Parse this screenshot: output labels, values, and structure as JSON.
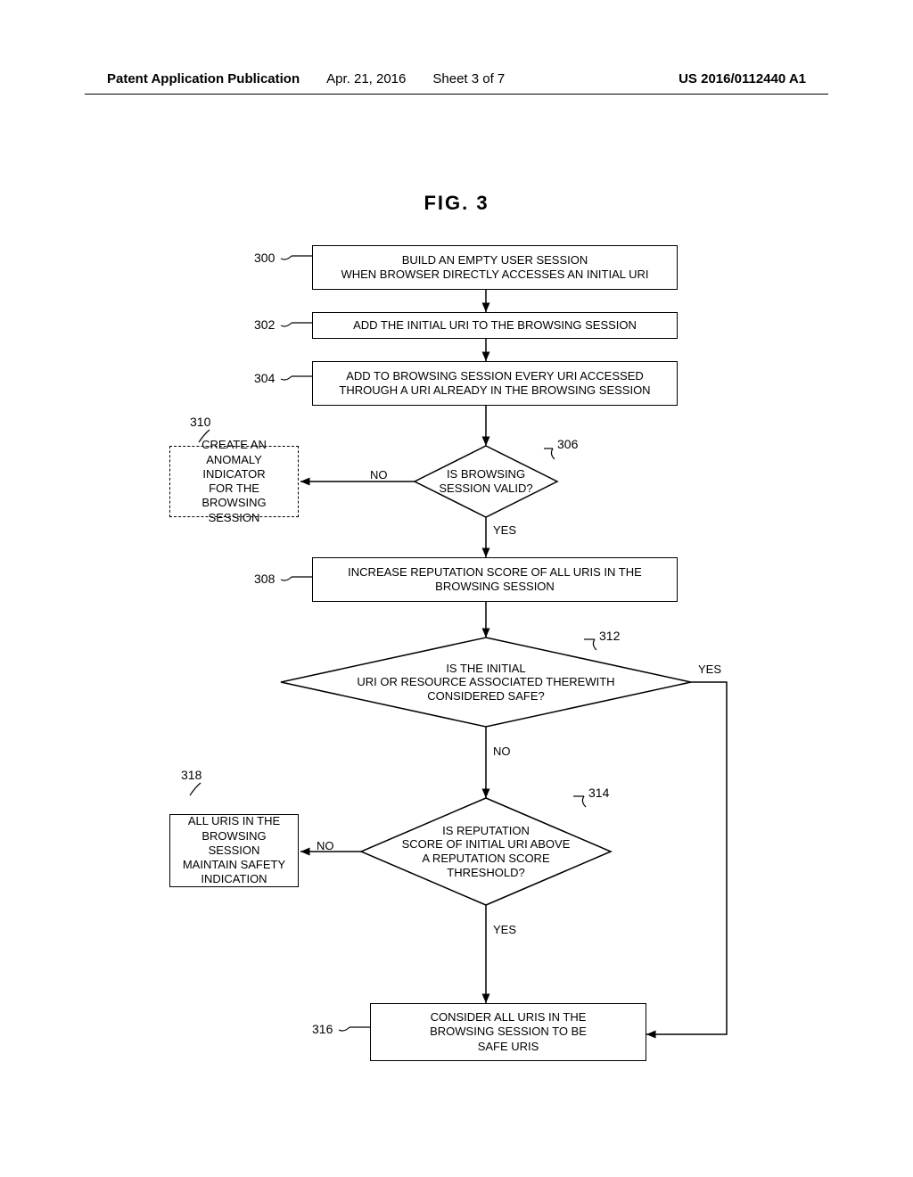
{
  "header": {
    "publication_label": "Patent Application Publication",
    "date": "Apr. 21, 2016",
    "sheet": "Sheet 3 of 7",
    "publication_number": "US 2016/0112440 A1"
  },
  "figure_title": "FIG. 3",
  "boxes": {
    "b300": "BUILD AN EMPTY USER SESSION\nWHEN BROWSER DIRECTLY ACCESSES AN INITIAL URI",
    "b302": "ADD THE INITIAL URI TO THE BROWSING SESSION",
    "b304": "ADD TO BROWSING SESSION EVERY URI ACCESSED\nTHROUGH A URI ALREADY IN THE BROWSING SESSION",
    "b310": "CREATE AN\nANOMALY INDICATOR\nFOR THE\nBROWSING SESSION",
    "b308": "INCREASE REPUTATION SCORE OF ALL URIS IN THE\nBROWSING SESSION",
    "b318": "ALL URIS IN THE\nBROWSING SESSION\nMAINTAIN SAFETY\nINDICATION",
    "b316": "CONSIDER ALL URIS IN THE\nBROWSING SESSION TO BE\nSAFE URIS"
  },
  "diamonds": {
    "d306": "IS BROWSING\nSESSION VALID?",
    "d312": "IS THE INITIAL\nURI OR RESOURCE ASSOCIATED THEREWITH\nCONSIDERED SAFE?",
    "d314": "IS REPUTATION\nSCORE OF INITIAL URI ABOVE\nA REPUTATION SCORE\nTHRESHOLD?"
  },
  "refs": {
    "r300": "300",
    "r302": "302",
    "r304": "304",
    "r306": "306",
    "r308": "308",
    "r310": "310",
    "r312": "312",
    "r314": "314",
    "r316": "316",
    "r318": "318"
  },
  "labels": {
    "no": "NO",
    "yes": "YES"
  },
  "chart_data": {
    "type": "flowchart",
    "nodes": [
      {
        "id": "300",
        "type": "process",
        "text": "BUILD AN EMPTY USER SESSION WHEN BROWSER DIRECTLY ACCESSES AN INITIAL URI"
      },
      {
        "id": "302",
        "type": "process",
        "text": "ADD THE INITIAL URI TO THE BROWSING SESSION"
      },
      {
        "id": "304",
        "type": "process",
        "text": "ADD TO BROWSING SESSION EVERY URI ACCESSED THROUGH A URI ALREADY IN THE BROWSING SESSION"
      },
      {
        "id": "306",
        "type": "decision",
        "text": "IS BROWSING SESSION VALID?"
      },
      {
        "id": "308",
        "type": "process",
        "text": "INCREASE REPUTATION SCORE OF ALL URIS IN THE BROWSING SESSION"
      },
      {
        "id": "310",
        "type": "process",
        "style": "dashed",
        "text": "CREATE AN ANOMALY INDICATOR FOR THE BROWSING SESSION"
      },
      {
        "id": "312",
        "type": "decision",
        "text": "IS THE INITIAL URI OR RESOURCE ASSOCIATED THEREWITH CONSIDERED SAFE?"
      },
      {
        "id": "314",
        "type": "decision",
        "text": "IS REPUTATION SCORE OF INITIAL URI ABOVE A REPUTATION SCORE THRESHOLD?"
      },
      {
        "id": "316",
        "type": "process",
        "text": "CONSIDER ALL URIS IN THE BROWSING SESSION TO BE SAFE URIS"
      },
      {
        "id": "318",
        "type": "process",
        "text": "ALL URIS IN THE BROWSING SESSION MAINTAIN SAFETY INDICATION"
      }
    ],
    "edges": [
      {
        "from": "300",
        "to": "302"
      },
      {
        "from": "302",
        "to": "304"
      },
      {
        "from": "304",
        "to": "306"
      },
      {
        "from": "306",
        "to": "310",
        "label": "NO"
      },
      {
        "from": "306",
        "to": "308",
        "label": "YES"
      },
      {
        "from": "308",
        "to": "312"
      },
      {
        "from": "312",
        "to": "316",
        "label": "YES"
      },
      {
        "from": "312",
        "to": "314",
        "label": "NO"
      },
      {
        "from": "314",
        "to": "318",
        "label": "NO"
      },
      {
        "from": "314",
        "to": "316",
        "label": "YES"
      }
    ]
  }
}
